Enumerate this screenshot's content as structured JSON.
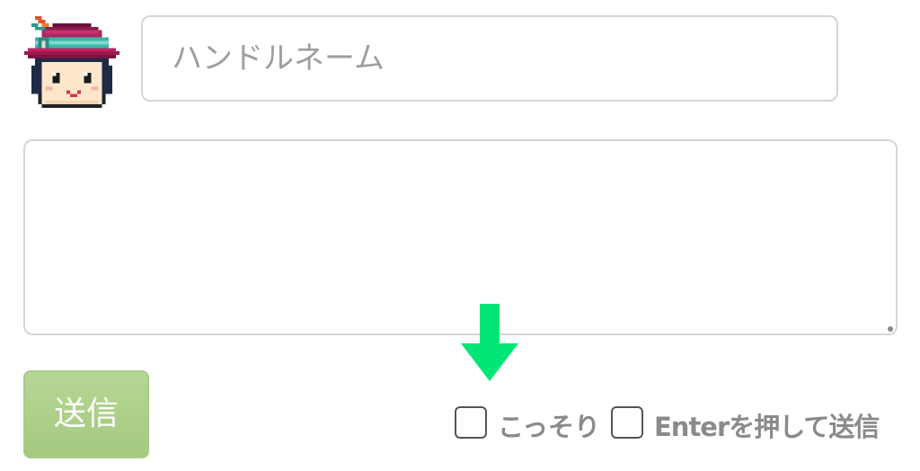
{
  "handle": {
    "placeholder": "ハンドルネーム",
    "value": ""
  },
  "message": {
    "value": ""
  },
  "send_button": {
    "label": "送信",
    "color": "#ade183"
  },
  "options": [
    {
      "label": "こっそり",
      "checked": false
    },
    {
      "label": "Enterを押して送信",
      "checked": false
    }
  ],
  "arrow": {
    "icon": "arrow-down-icon",
    "color": "#00e676"
  },
  "avatar": {
    "icon": "pixel-avatar-hat-icon"
  }
}
